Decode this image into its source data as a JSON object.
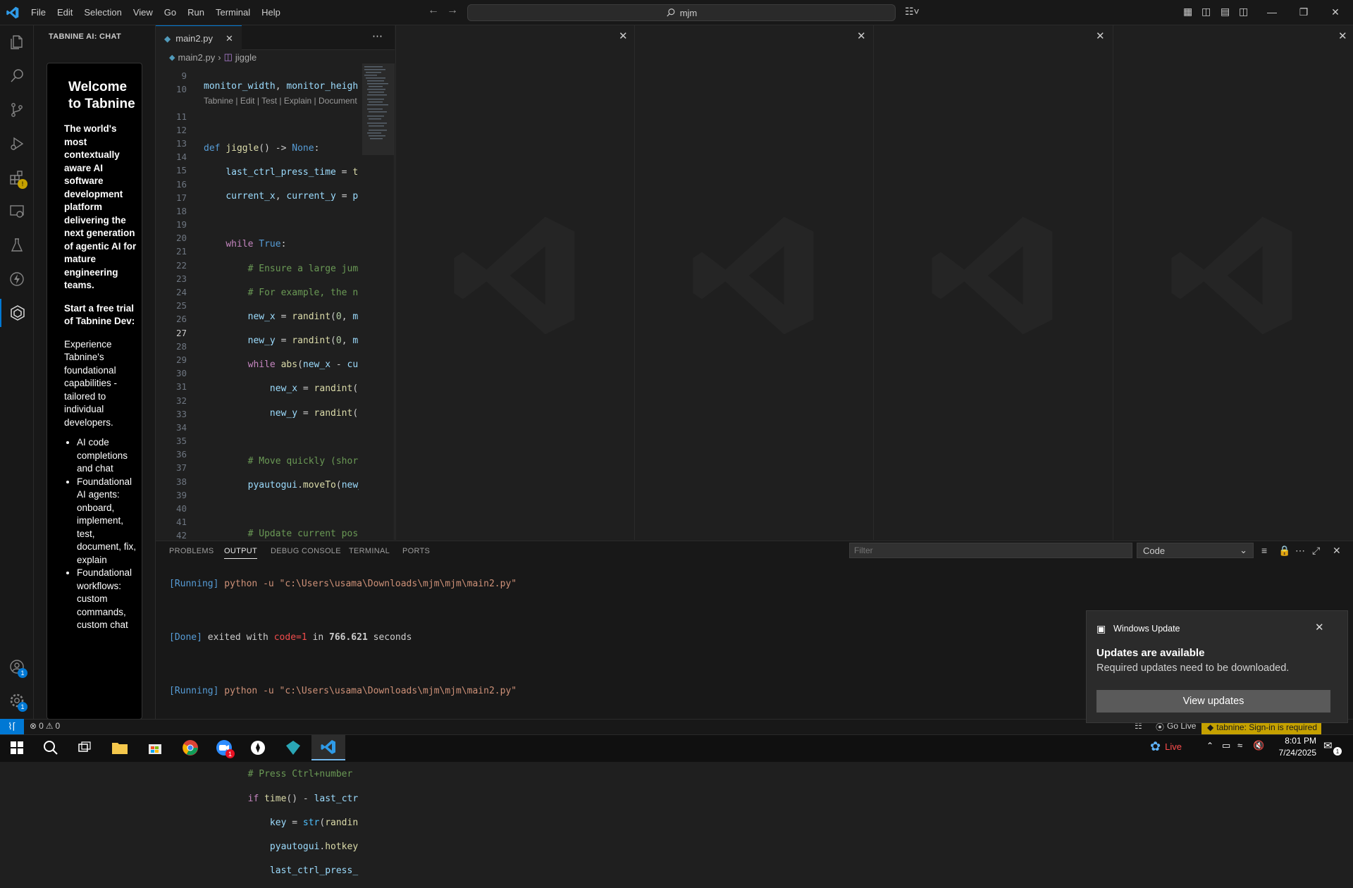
{
  "titlebar": {
    "menus": [
      "File",
      "Edit",
      "Selection",
      "View",
      "Go",
      "Run",
      "Terminal",
      "Help"
    ],
    "search_text": "mjm"
  },
  "sidebar": {
    "title": "TABNINE AI: CHAT",
    "welcome": {
      "heading": "Welcome to Tabnine",
      "intro": "The world's most contextually aware AI software development platform delivering the next generation of agentic AI for mature engineering teams.",
      "trial": "Start a free trial of Tabnine Dev:",
      "experience": "Experience Tabnine's foundational capabilities - tailored to individual developers.",
      "bullets": [
        "AI code completions and chat",
        "Foundational AI agents: onboard, implement, test, document, fix, explain",
        "Foundational workflows: custom commands, custom chat"
      ]
    },
    "badges": {
      "accounts": "1",
      "settings": "1"
    }
  },
  "editor": {
    "tab_label": "main2.py",
    "breadcrumb_file": "main2.py",
    "breadcrumb_symbol": "jiggle",
    "codelens": "Tabnine | Edit | Test | Explain | Document",
    "line_numbers": [
      "9",
      "10",
      "11",
      "12",
      "13",
      "14",
      "15",
      "16",
      "17",
      "18",
      "19",
      "20",
      "21",
      "22",
      "23",
      "24",
      "25",
      "26",
      "27",
      "28",
      "29",
      "30",
      "31",
      "32",
      "33",
      "34",
      "35",
      "36",
      "37",
      "38",
      "39",
      "40",
      "41",
      "42"
    ],
    "active_line": "27"
  },
  "panel": {
    "tabs": [
      "PROBLEMS",
      "OUTPUT",
      "DEBUG CONSOLE",
      "TERMINAL",
      "PORTS"
    ],
    "active_tab": "OUTPUT",
    "filter_placeholder": "Filter",
    "channel": "Code",
    "output": {
      "line1_tag": "[Running]",
      "line1_cmd": " python -u \"c:\\Users\\usama\\Downloads\\mjm\\mjm\\main2.py\"",
      "line2_tag": "[Done]",
      "line2_a": " exited with ",
      "line2_code": "code=1",
      "line2_b": " in ",
      "line2_secs": "766.621",
      "line2_c": " seconds",
      "line3_tag": "[Running]",
      "line3_cmd": " python -u \"c:\\Users\\usama\\Downloads\\mjm\\mjm\\main2.py\""
    }
  },
  "statusbar": {
    "errors": "0",
    "warnings": "0",
    "go_live": "Go Live",
    "tabnine": "tabnine: Sign-in is required"
  },
  "toast": {
    "app": "Windows Update",
    "title": "Updates are available",
    "body": "Required updates need to be downloaded.",
    "button": "View updates"
  },
  "taskbar": {
    "weather": "Live",
    "time": "8:01 PM",
    "date": "7/24/2025",
    "zoom_badge": "1",
    "notif_badge": "1"
  },
  "colors": {
    "accent": "#0078d4",
    "tabnine": "#c5a100",
    "bg": "#1f1f1f"
  }
}
